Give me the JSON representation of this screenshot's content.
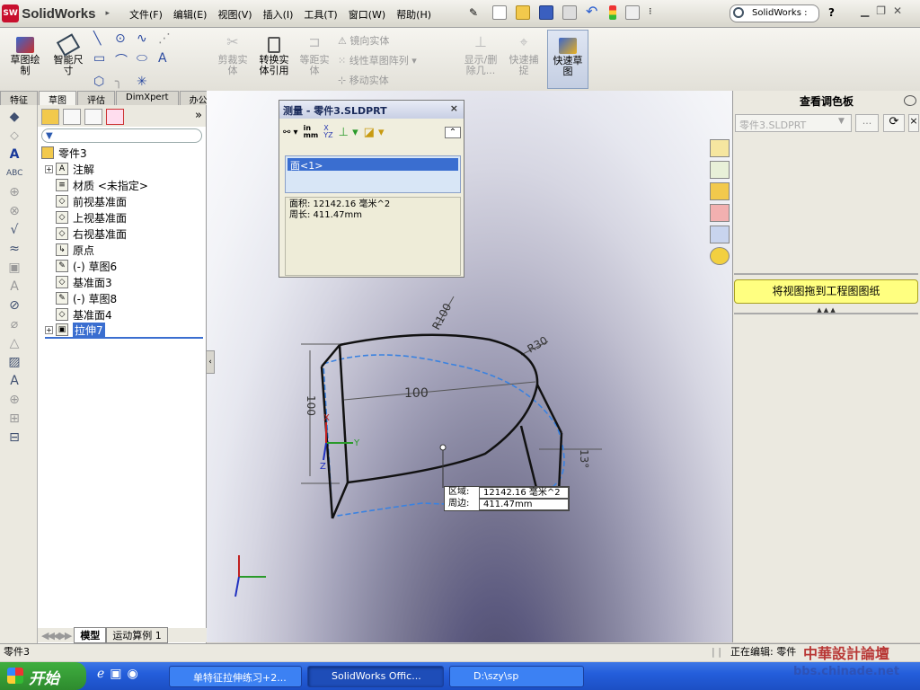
{
  "app": {
    "logo_text": "SolidWorks",
    "logo_badge": "SW"
  },
  "menu": [
    "文件(F)",
    "编辑(E)",
    "视图(V)",
    "插入(I)",
    "工具(T)",
    "窗口(W)",
    "帮助(H)"
  ],
  "search": {
    "placeholder": "SolidWorks :",
    "help": "?"
  },
  "command_manager": {
    "buttons": [
      {
        "label": "草图绘\n制",
        "enabled": true
      },
      {
        "label": "智能尺\n寸",
        "enabled": true
      },
      {
        "label": "剪裁实\n体",
        "enabled": false
      },
      {
        "label": "转换实\n体引用",
        "enabled": true
      },
      {
        "label": "等距实\n体",
        "enabled": false
      },
      {
        "label": "显示/删\n除几...",
        "enabled": false
      },
      {
        "label": "快速捕\n捉",
        "enabled": false
      },
      {
        "label": "快速草\n图",
        "enabled": true
      }
    ],
    "small": [
      {
        "label": "镜向实体",
        "enabled": false
      },
      {
        "label": "线性草图阵列",
        "enabled": false
      },
      {
        "label": "移动实体",
        "enabled": false
      }
    ]
  },
  "tabs": [
    "特征",
    "草图",
    "评估",
    "DimXpert",
    "办公室产品"
  ],
  "active_tab": 1,
  "feature_tree": {
    "root": "零件3",
    "nodes": [
      {
        "label": "注解",
        "expandable": true,
        "icon": "A"
      },
      {
        "label": "材质 <未指定>",
        "expandable": false,
        "icon": "≡"
      },
      {
        "label": "前视基准面",
        "expandable": false,
        "icon": "◇"
      },
      {
        "label": "上视基准面",
        "expandable": false,
        "icon": "◇"
      },
      {
        "label": "右视基准面",
        "expandable": false,
        "icon": "◇"
      },
      {
        "label": "原点",
        "expandable": false,
        "icon": "↳"
      },
      {
        "label": "(-) 草图6",
        "expandable": false,
        "icon": "✎"
      },
      {
        "label": "基准面3",
        "expandable": false,
        "icon": "◇"
      },
      {
        "label": "(-) 草图8",
        "expandable": false,
        "icon": "✎"
      },
      {
        "label": "基准面4",
        "expandable": false,
        "icon": "◇"
      },
      {
        "label": "拉伸7",
        "expandable": true,
        "icon": "▣",
        "selected": true
      }
    ],
    "bottom_tabs": [
      "模型",
      "运动算例 1"
    ]
  },
  "measure_dialog": {
    "title": "测量 - 零件3.SLDPRT",
    "unit_label": "in\nmm",
    "xyz_label": "X\nYZ",
    "selection": "面<1>",
    "result_area": "面积: 12142.16 毫米^2",
    "result_perimeter": "周长: 411.47mm",
    "close": "×",
    "collapse": "⌃"
  },
  "model": {
    "dims": [
      "R100",
      "R30",
      "100",
      "100",
      "13°"
    ],
    "tooltip_rows": [
      {
        "k": "区域:",
        "v": "12142.16 毫米^2"
      },
      {
        "k": "周边:",
        "v": "411.47mm"
      }
    ],
    "axes": {
      "x": "X",
      "y": "Y",
      "z": "Z"
    }
  },
  "task_pane": {
    "title": "查看调色板",
    "combo_value": "零件3.SLDPRT",
    "combo_btn": "...",
    "drag_text": "将视图拖到工程图图纸",
    "handle": "▲ ▲ ▲"
  },
  "status_bar": {
    "left": "零件3",
    "right": "正在编辑: 零件"
  },
  "taskbar": {
    "start": "开始",
    "tasks": [
      "单特征拉伸练习+2...",
      "SolidWorks Offic...",
      "D:\\szy\\sp"
    ]
  },
  "watermark": {
    "line1": "中華設計論壇",
    "line2": "bbs.chinade.net"
  }
}
